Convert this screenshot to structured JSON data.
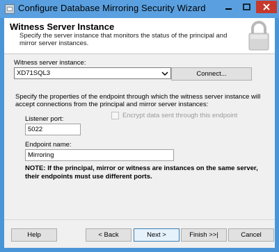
{
  "window": {
    "title": "Configure Database Mirroring Security Wizard"
  },
  "header": {
    "title": "Witness Server Instance",
    "description": "Specify the server instance that monitors the status of the principal and mirror server instances."
  },
  "witness": {
    "label": "Witness server instance:",
    "selected_value": "XD71SQL3",
    "connect_label": "Connect..."
  },
  "endpoint": {
    "intro": "Specify the properties of the endpoint through which the witness server instance will accept connections from the principal and mirror server instances:",
    "listener_port_label": "Listener port:",
    "listener_port_value": "5022",
    "encrypt_label": "Encrypt data sent through this endpoint",
    "encrypt_checked": false,
    "endpoint_name_label": "Endpoint name:",
    "endpoint_name_value": "Mirroring"
  },
  "note": "NOTE: If the principal, mirror or witness are instances on the same server, their endpoints must use different ports.",
  "footer": {
    "help_label": "Help",
    "back_label": "< Back",
    "next_label": "Next >",
    "finish_label": "Finish >>|",
    "cancel_label": "Cancel"
  },
  "icons": {
    "app": "wizard-app-icon",
    "lock": "padlock-icon",
    "dropdown": "chevron-down-icon"
  }
}
